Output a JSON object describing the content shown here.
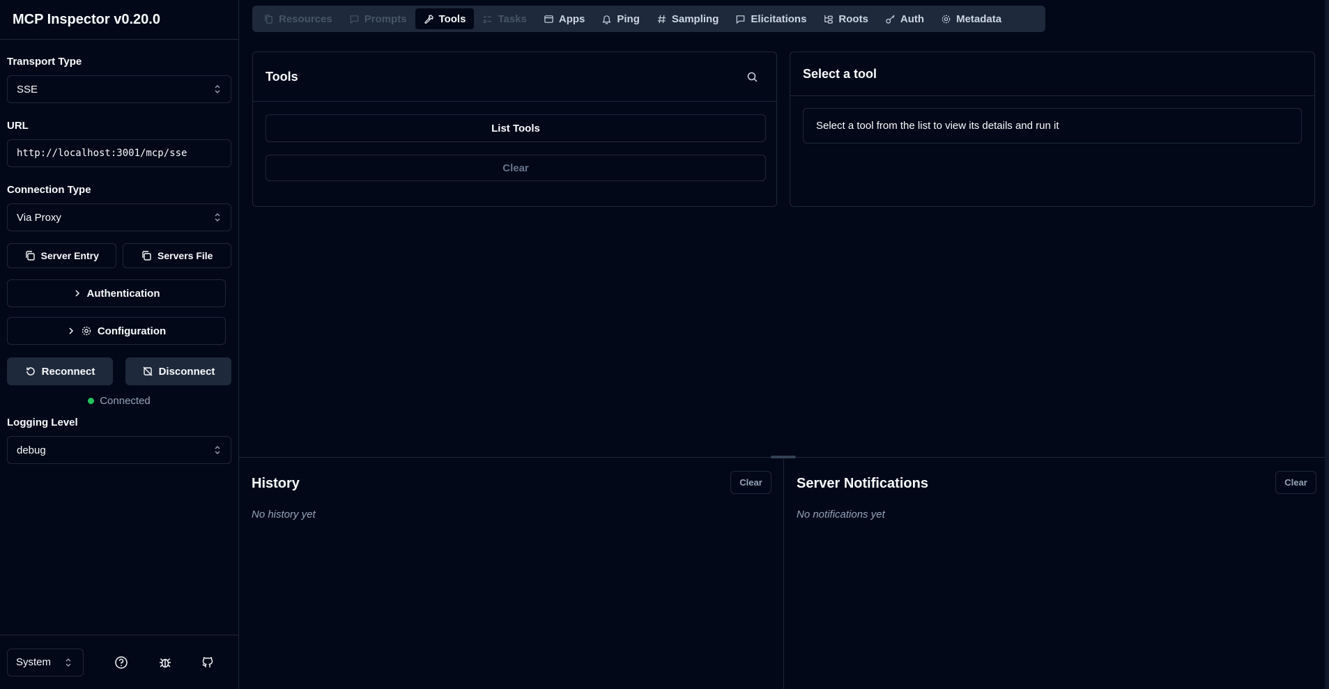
{
  "app": {
    "title": "MCP Inspector v0.20.0"
  },
  "sidebar": {
    "transport_label": "Transport Type",
    "transport_value": "SSE",
    "url_label": "URL",
    "url_value": "http://localhost:3001/mcp/sse",
    "connection_label": "Connection Type",
    "connection_value": "Via Proxy",
    "server_entry": "Server Entry",
    "servers_file": "Servers File",
    "authentication": "Authentication",
    "configuration": "Configuration",
    "reconnect": "Reconnect",
    "disconnect": "Disconnect",
    "status": "Connected",
    "status_color": "#22c55e",
    "logging_label": "Logging Level",
    "logging_value": "debug",
    "theme_value": "System"
  },
  "tabs": [
    {
      "label": "Resources",
      "icon": "files-icon",
      "state": "disabled"
    },
    {
      "label": "Prompts",
      "icon": "message-square-icon",
      "state": "disabled"
    },
    {
      "label": "Tools",
      "icon": "hammer-icon",
      "state": "active"
    },
    {
      "label": "Tasks",
      "icon": "list-todo-icon",
      "state": "disabled"
    },
    {
      "label": "Apps",
      "icon": "app-window-icon",
      "state": "enabled"
    },
    {
      "label": "Ping",
      "icon": "bell-icon",
      "state": "enabled"
    },
    {
      "label": "Sampling",
      "icon": "hash-icon",
      "state": "enabled"
    },
    {
      "label": "Elicitations",
      "icon": "message-square-icon",
      "state": "enabled"
    },
    {
      "label": "Roots",
      "icon": "folder-tree-icon",
      "state": "enabled"
    },
    {
      "label": "Auth",
      "icon": "key-icon",
      "state": "enabled"
    },
    {
      "label": "Metadata",
      "icon": "settings-icon",
      "state": "enabled"
    }
  ],
  "tools_panel": {
    "title": "Tools",
    "list_button": "List Tools",
    "clear_button": "Clear"
  },
  "detail_panel": {
    "title": "Select a tool",
    "message": "Select a tool from the list to view its details and run it"
  },
  "history": {
    "title": "History",
    "clear": "Clear",
    "empty": "No history yet"
  },
  "notifications": {
    "title": "Server Notifications",
    "clear": "Clear",
    "empty": "No notifications yet"
  }
}
